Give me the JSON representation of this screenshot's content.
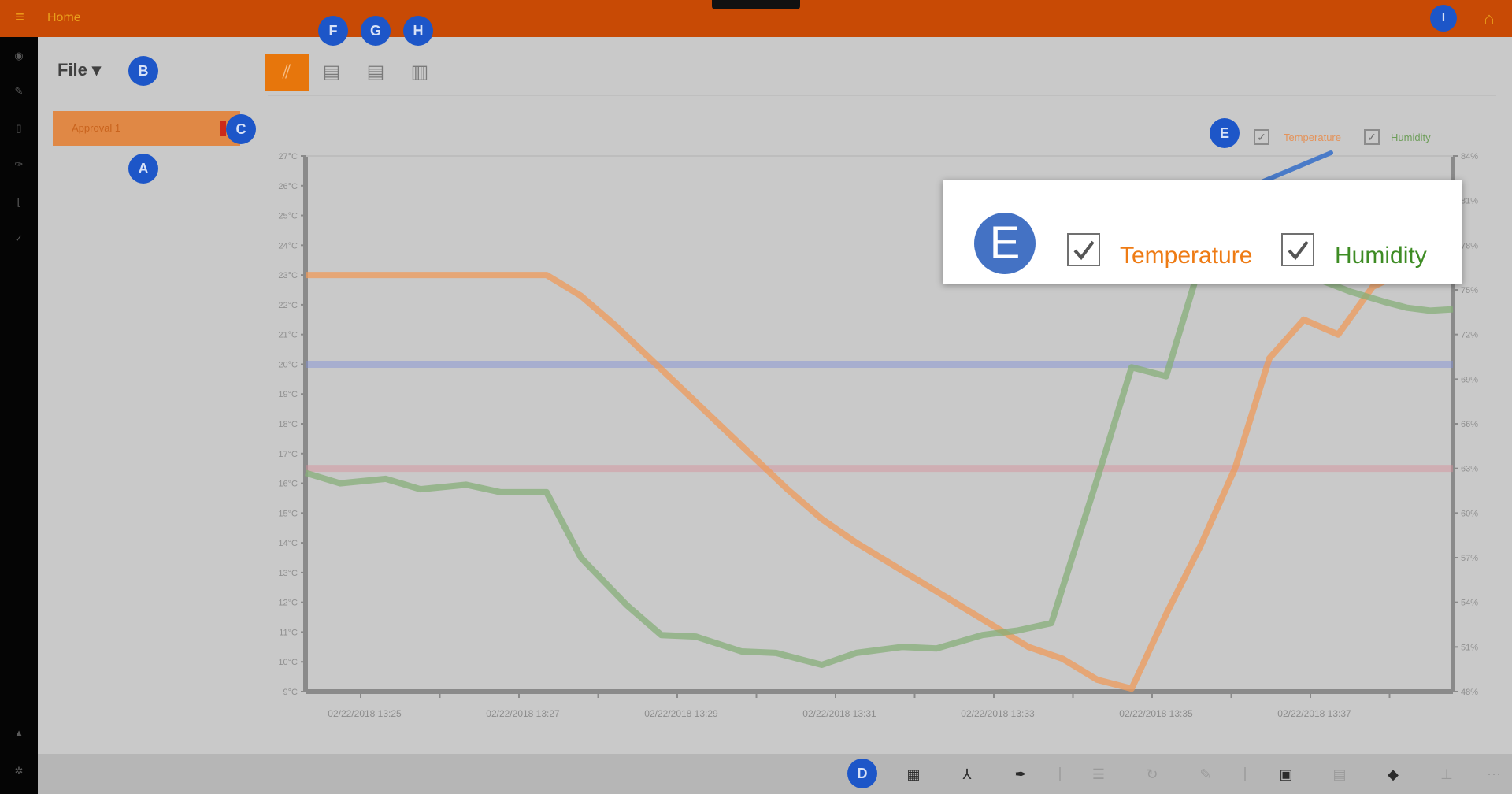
{
  "topbar": {
    "menu_icon": "hamburger-icon",
    "title": "Home",
    "home_icon": "home-icon",
    "accent": "#c84a05"
  },
  "file_menu": {
    "label": "File ▾"
  },
  "approval_item": {
    "label": "Approval 1"
  },
  "badges": {
    "a": "A",
    "b": "B",
    "c": "C",
    "d": "D",
    "e": "E",
    "f": "F",
    "g": "G",
    "h": "H",
    "i": "I"
  },
  "chart_tools": [
    "chart-icon",
    "clipboard-icon",
    "clipboard-copy-icon",
    "trash-icon"
  ],
  "legend": {
    "temperature": {
      "label": "Temperature",
      "checked": true,
      "color": "#ee7b14"
    },
    "humidity": {
      "label": "Humidity",
      "checked": true,
      "color": "#3e8c24"
    }
  },
  "callout": {
    "badge": "E",
    "temperature_label": "Temperature",
    "humidity_label": "Humidity"
  },
  "chart_data": {
    "type": "line",
    "x": [
      "02/22/2018 13:25",
      "02/22/2018 13:27",
      "02/22/2018 13:29",
      "02/22/2018 13:31",
      "02/22/2018 13:33",
      "02/22/2018 13:35",
      "02/22/2018 13:37"
    ],
    "left_axis": {
      "ylim": [
        9,
        27
      ],
      "ticks": [
        "27°C",
        "26°C",
        "25°C",
        "24°C",
        "23°C",
        "22°C",
        "21°C",
        "20°C",
        "19°C",
        "18°C",
        "17°C",
        "16°C",
        "15°C",
        "14°C",
        "13°C",
        "12°C",
        "11°C",
        "10°C",
        "9°C"
      ]
    },
    "right_axis": {
      "ylim": [
        48,
        84
      ],
      "ticks": [
        "84%",
        "81%",
        "78%",
        "75%",
        "72%",
        "69%",
        "66%",
        "63%",
        "60%",
        "57%",
        "54%",
        "51%",
        "48%"
      ]
    },
    "thresholds": [
      {
        "axis": "left",
        "value": 20,
        "color": "#7f8fd8"
      },
      {
        "axis": "left",
        "value": 16.5,
        "color": "#d88f9a"
      }
    ],
    "series": [
      {
        "name": "Temperature",
        "axis": "left",
        "color": "#ee9a5a",
        "values": [
          23,
          23,
          23,
          23,
          23,
          23,
          23,
          23,
          22.3,
          21.3,
          20.2,
          19.1,
          18,
          16.9,
          15.8,
          14.8,
          14,
          13.3,
          12.6,
          11.9,
          11.2,
          10.5,
          10.1,
          9.4,
          9.1,
          11.6,
          13.9,
          16.5,
          20.2,
          21.5,
          21,
          22.6,
          23.9
        ],
        "x": [
          0,
          0.03,
          0.06,
          0.09,
          0.12,
          0.15,
          0.18,
          0.21,
          0.24,
          0.27,
          0.3,
          0.33,
          0.36,
          0.39,
          0.42,
          0.45,
          0.48,
          0.51,
          0.54,
          0.57,
          0.6,
          0.63,
          0.66,
          0.69,
          0.72,
          0.75,
          0.78,
          0.81,
          0.84,
          0.87,
          0.9,
          0.93,
          1.0
        ]
      },
      {
        "name": "Humidity",
        "axis": "right",
        "color": "#86ae78",
        "values": [
          62.7,
          62,
          62.3,
          61.6,
          61.9,
          61.4,
          61.4,
          57,
          53.8,
          51.8,
          51.7,
          50.7,
          50.6,
          49.8,
          50.6,
          51,
          50.9,
          51.8,
          52.1,
          52.6,
          62.3,
          69.8,
          69.2,
          76.8,
          80.4,
          78.6,
          75.8,
          74.9,
          74.2,
          73.8,
          73.6,
          73.7
        ],
        "x": [
          0,
          0.03,
          0.07,
          0.1,
          0.14,
          0.17,
          0.21,
          0.24,
          0.28,
          0.31,
          0.34,
          0.38,
          0.41,
          0.45,
          0.48,
          0.52,
          0.55,
          0.59,
          0.62,
          0.65,
          0.69,
          0.72,
          0.75,
          0.78,
          0.82,
          0.85,
          0.88,
          0.91,
          0.94,
          0.96,
          0.98,
          1.0
        ]
      }
    ]
  },
  "bottom_icons": [
    "add-icon",
    "grid-icon",
    "tree-icon",
    "pen-icon",
    "list-icon",
    "sync-icon",
    "wrench-icon",
    "chip-icon",
    "layers-icon",
    "stack-icon",
    "export-icon",
    "more-icon"
  ]
}
